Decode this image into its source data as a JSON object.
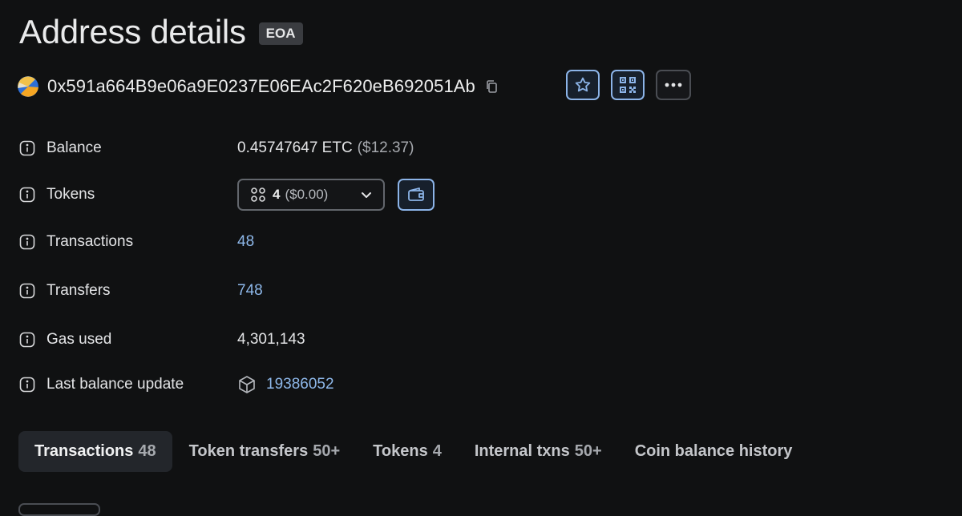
{
  "header": {
    "title": "Address details",
    "badge": "EOA"
  },
  "address": {
    "hash": "0x591a664B9e06a9E0237E06EAc2F620eB692051Ab"
  },
  "actions": {
    "star_icon": "star-icon",
    "qr_icon": "qr-code-icon",
    "more_icon": "more-horizontal-icon"
  },
  "details": {
    "balance": {
      "label": "Balance",
      "value": "0.45747647 ETC",
      "usd": "($12.37)"
    },
    "tokens": {
      "label": "Tokens",
      "count": "4",
      "usd": "($0.00)"
    },
    "transactions": {
      "label": "Transactions",
      "value": "48"
    },
    "transfers": {
      "label": "Transfers",
      "value": "748"
    },
    "gas_used": {
      "label": "Gas used",
      "value": "4,301,143"
    },
    "last_balance_update": {
      "label": "Last balance update",
      "value": "19386052"
    }
  },
  "tabs": [
    {
      "label": "Transactions",
      "count": "48"
    },
    {
      "label": "Token transfers",
      "count": "50+"
    },
    {
      "label": "Tokens",
      "count": "4"
    },
    {
      "label": "Internal txns",
      "count": "50+"
    },
    {
      "label": "Coin balance history",
      "count": ""
    }
  ],
  "colors": {
    "background": "#101112",
    "link": "#8eb8ea",
    "accent_border": "#8cb4e8"
  }
}
